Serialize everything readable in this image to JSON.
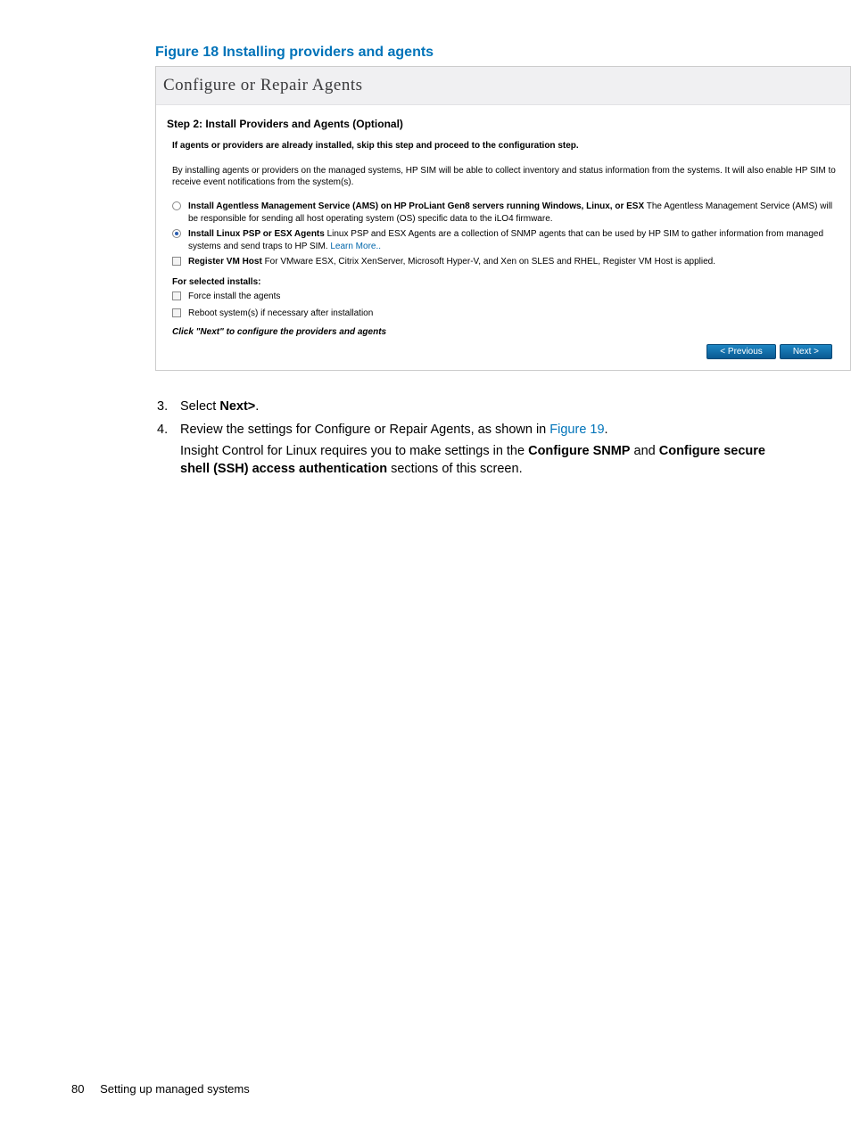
{
  "figure_caption": "Figure 18 Installing providers and agents",
  "panel": {
    "header": "Configure or Repair Agents",
    "step_title": "Step 2: Install Providers and Agents  (Optional)",
    "note": "If agents or providers are already installed, skip this step and proceed to the configuration step.",
    "desc": "By installing agents or providers on the managed systems, HP SIM will be able to collect inventory and status information from the systems. It will also enable HP SIM to receive event notifications from the system(s).",
    "opt1_bold": "Install Agentless Management Service (AMS) on HP ProLiant Gen8 servers running Windows, Linux, or ESX",
    "opt1_rest": "    The Agentless Management Service (AMS) will be responsible for sending all host operating system (OS) specific data to the iLO4 firmware.",
    "opt2_bold": "Install Linux PSP or ESX Agents",
    "opt2_rest": "    Linux PSP and ESX Agents are a collection of SNMP agents that can be used by HP SIM to gather information from managed systems and send traps to HP SIM.    ",
    "opt2_link": "Learn More..",
    "opt3_bold": "Register VM Host",
    "opt3_rest": "    For VMware ESX, Citrix XenServer, Microsoft Hyper-V, and Xen on SLES and RHEL, Register VM Host is applied.",
    "selected_label": "For selected installs:",
    "chk1": "Force install the agents",
    "chk2": "Reboot system(s) if necessary after installation",
    "click_next": "Click \"Next\" to configure the providers and agents",
    "prev_btn": "< Previous",
    "next_btn": "Next >"
  },
  "steps": {
    "s3_num": "3.",
    "s3_pre": "Select ",
    "s3_bold": "Next>",
    "s3_post": ".",
    "s4_num": "4.",
    "s4_pre": "Review the settings for Configure or Repair Agents, as shown in ",
    "s4_xref": "Figure 19",
    "s4_post": ".",
    "s4p2_a": "Insight Control for Linux requires you to make settings in the ",
    "s4p2_b1": "Configure SNMP",
    "s4p2_b": " and ",
    "s4p2_b2": "Configure secure shell (SSH) access authentication",
    "s4p2_c": " sections of this screen."
  },
  "footer": {
    "page": "80",
    "section": "Setting up managed systems"
  }
}
